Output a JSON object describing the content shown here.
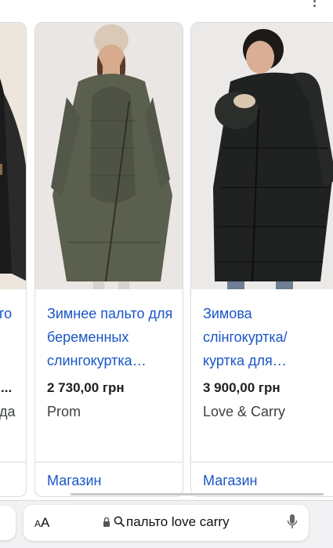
{
  "products": [
    {
      "title_tail": "го",
      "price_tail": "...",
      "seller_tail": "да"
    },
    {
      "title": "Зимнее пальто для беременных слингокуртка…",
      "price": "2 730,00 грн",
      "seller": "Prom",
      "action": "Магазин"
    },
    {
      "title": "Зимова слінгокуртка/ куртка для…",
      "price": "3 900,00 грн",
      "seller": "Love & Carry",
      "action": "Магазин"
    }
  ],
  "browser": {
    "text_size_label": "AA",
    "url": "пальто love carry"
  },
  "icons": {
    "more": "more-vert-icon",
    "lock": "lock-icon",
    "search": "search-icon",
    "mic": "microphone-icon"
  },
  "colors": {
    "link": "#1a56c6",
    "coat_olive": "#5b5f4e",
    "coat_black": "#1f2220"
  }
}
